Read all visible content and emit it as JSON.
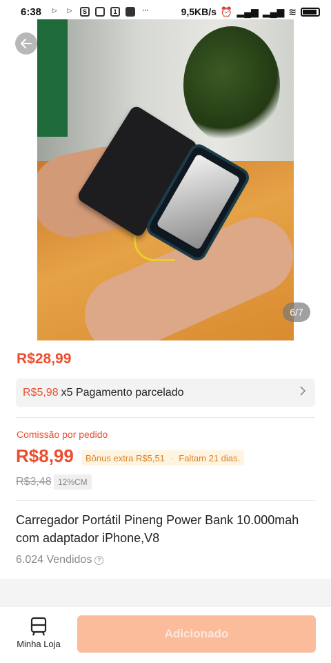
{
  "status_bar": {
    "time": "6:38",
    "network_speed": "9,5KB/s"
  },
  "gallery": {
    "counter": "6/7"
  },
  "price": {
    "main": "R$28,99"
  },
  "installment": {
    "price": "R$5,98",
    "text": "x5 Pagamento parcelado"
  },
  "commission": {
    "label": "Comissão por pedido",
    "value": "R$8,99",
    "bonus": "Bônus extra R$5,51",
    "remaining": "Faltam 21 dias.",
    "old_value": "R$3,48",
    "rate_badge": "12%CM"
  },
  "product": {
    "title": "Carregador Portátil Pineng Power Bank 10.000mah com adaptador iPhone,V8",
    "sold": "6.024 Vendidos"
  },
  "bottom_bar": {
    "my_store_label": "Minha Loja",
    "add_button_label": "Adicionado"
  },
  "colors": {
    "accent": "#ee4d2d",
    "bonus_text": "#d9822b",
    "button_disabled": "#fbbc9c"
  }
}
